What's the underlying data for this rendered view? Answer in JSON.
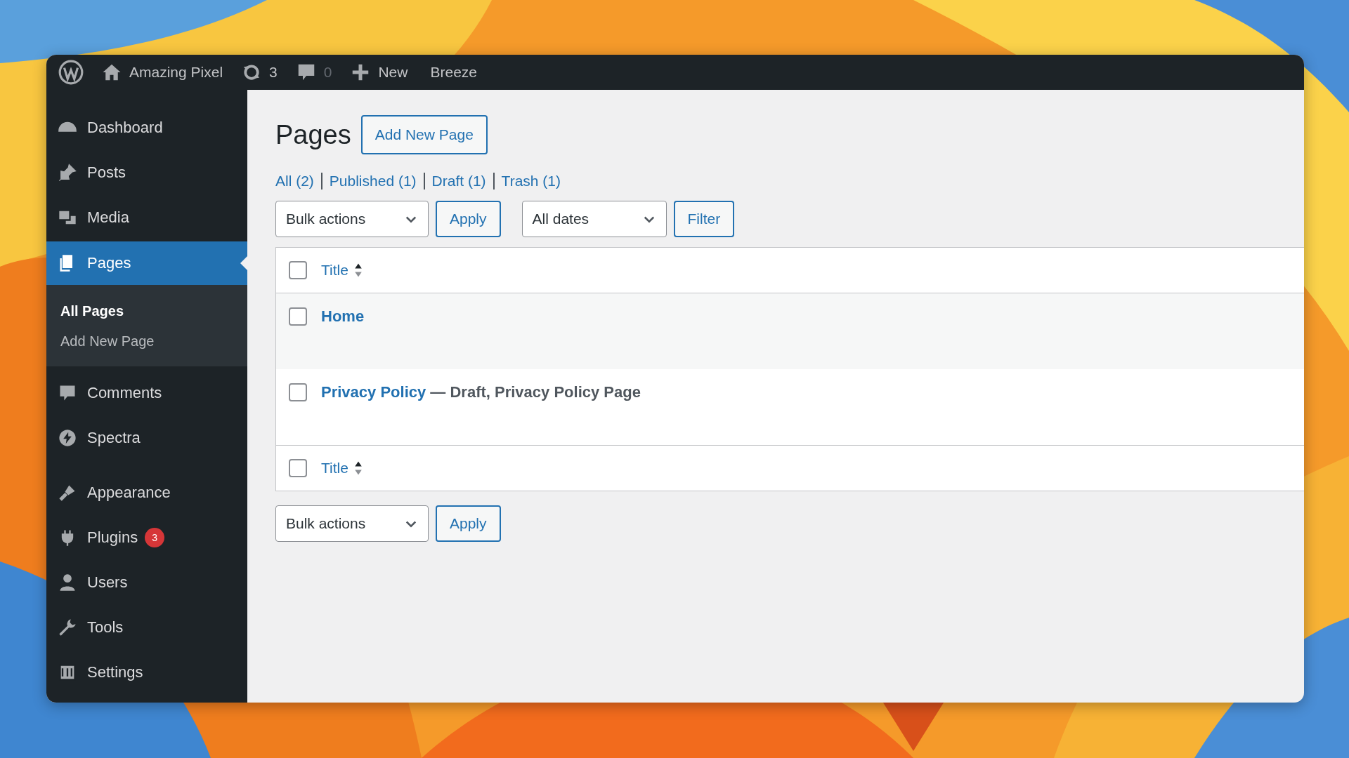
{
  "admin_bar": {
    "site": "Amazing Pixel",
    "updates": "3",
    "comments": "0",
    "new_label": "New",
    "items": [
      "Breeze"
    ]
  },
  "sidebar": {
    "items": [
      {
        "label": "Dashboard",
        "selected": false
      },
      {
        "label": "Posts",
        "selected": false
      },
      {
        "label": "Media",
        "selected": false
      },
      {
        "label": "Pages",
        "selected": true,
        "children": [
          {
            "label": "All Pages",
            "selected": true
          },
          {
            "label": "Add New Page",
            "selected": false
          }
        ]
      },
      {
        "label": "Comments",
        "selected": false
      },
      {
        "label": "Spectra",
        "selected": false
      },
      {
        "label": "Appearance",
        "selected": false
      },
      {
        "label": "Plugins",
        "selected": false,
        "badge": "3"
      },
      {
        "label": "Users",
        "selected": false
      },
      {
        "label": "Tools",
        "selected": false
      },
      {
        "label": "Settings",
        "selected": false
      }
    ]
  },
  "page": {
    "title": "Pages",
    "add_button": "Add New Page",
    "filters": [
      {
        "label": "All (2)"
      },
      {
        "label": "Published (1)"
      },
      {
        "label": "Draft (1)"
      },
      {
        "label": "Trash (1)"
      }
    ],
    "bulk_actions": "Bulk actions",
    "apply": "Apply",
    "dates": "All dates",
    "filter": "Filter",
    "table": {
      "header": {
        "title": "Title",
        "checked": false
      },
      "rows": [
        {
          "title": "Home",
          "state": "",
          "checked": false
        },
        {
          "title": "Privacy Policy",
          "state": " — Draft, Privacy Policy Page",
          "checked": false
        }
      ],
      "footer": {
        "title": "Title",
        "checked": false
      }
    },
    "bottom_bulk_actions": "Bulk actions",
    "bottom_apply": "Apply"
  }
}
